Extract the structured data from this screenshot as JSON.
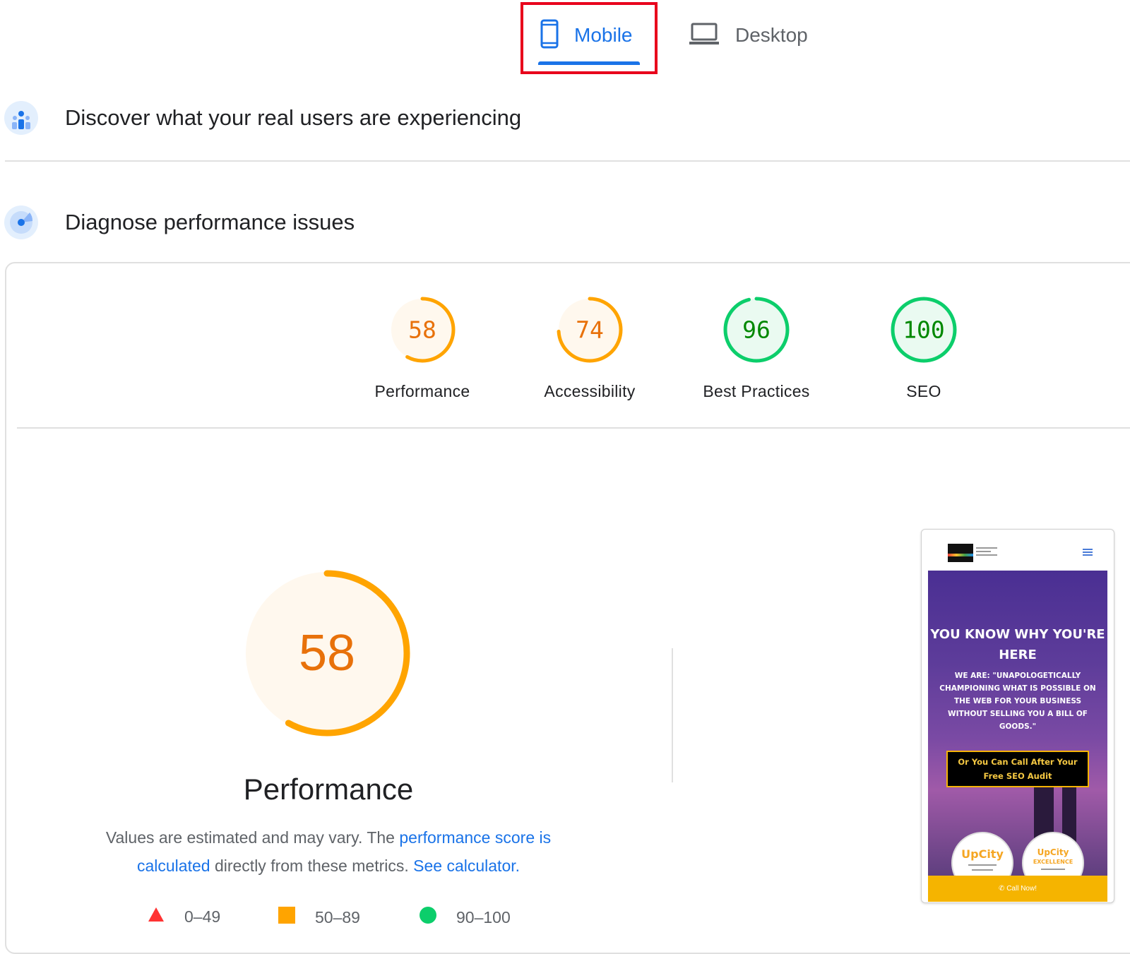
{
  "tabs": [
    {
      "label": "Mobile",
      "icon": "smartphone-icon",
      "active": true
    },
    {
      "label": "Desktop",
      "icon": "laptop-icon",
      "active": false
    }
  ],
  "sections": {
    "discover": {
      "title": "Discover what your real users are experiencing",
      "icon": "users-chart-icon"
    },
    "diagnose": {
      "title": "Diagnose performance issues",
      "icon": "lighthouse-icon"
    }
  },
  "scores": [
    {
      "value": "58",
      "label": "Performance",
      "score": 58,
      "rating": "average"
    },
    {
      "value": "74",
      "label": "Accessibility",
      "score": 74,
      "rating": "average"
    },
    {
      "value": "96",
      "label": "Best Practices",
      "score": 96,
      "rating": "pass"
    },
    {
      "value": "100",
      "label": "SEO",
      "score": 100,
      "rating": "pass"
    }
  ],
  "main_score": {
    "value": "58",
    "score": 58,
    "title": "Performance"
  },
  "note": {
    "text1": "Values are estimated and may vary. The ",
    "link1": "performance score is calculated",
    "text2": " directly from these metrics. ",
    "link2": "See calculator."
  },
  "legend": [
    {
      "icon": "red-triangle-icon",
      "label": "0–49"
    },
    {
      "icon": "orange-square-icon",
      "label": "50–89"
    },
    {
      "icon": "green-circle-icon",
      "label": "90–100"
    }
  ],
  "colors": {
    "average": "#e8710a",
    "average_ring": "#ffa400",
    "average_bg": "#fff8ee",
    "pass": "#008800",
    "pass_ring": "#0cce6b",
    "pass_bg": "#eafaf1",
    "fail": "#ff3333",
    "link": "#1a73e8"
  },
  "screenshot": {
    "headline": "YOU KNOW WHY YOU'RE HERE",
    "subtext": "WE ARE: \"UNAPOLOGETICALLY CHAMPIONING WHAT IS POSSIBLE ON THE WEB FOR YOUR BUSINESS WITHOUT SELLING YOU A BILL OF GOODS.\"",
    "button": "Or You Can Call After Your Free SEO Audit",
    "badge1": "UpCity",
    "badge2_brand": "UpCity",
    "badge2": "EXCELLENCE",
    "call": "Call Now!"
  }
}
